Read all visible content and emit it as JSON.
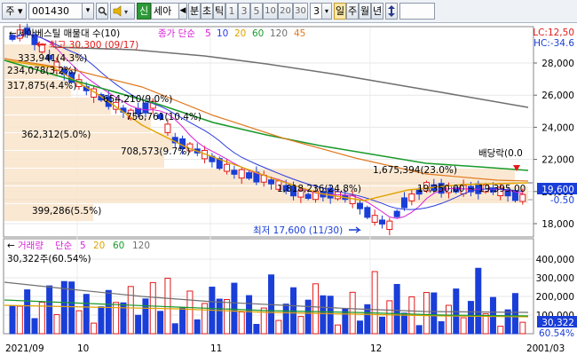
{
  "toolbar": {
    "market": "주",
    "code": "001430",
    "stock_short": "세아",
    "items": [
      "분",
      "초",
      "틱",
      "1",
      "3",
      "5",
      "10",
      "20",
      "30",
      "3",
      "일",
      "주",
      "월",
      "년"
    ],
    "interval_value": "3"
  },
  "price_legend": {
    "title": "세아베스틸 매물대 수(10)",
    "ma_label": "종가 단순",
    "ma_periods": [
      "5",
      "10",
      "20",
      "60",
      "120",
      "45"
    ],
    "colors": [
      "#d81fd8",
      "#2a3ae0",
      "#e0a200",
      "#1a9a2a",
      "#707070",
      "#e07a20"
    ]
  },
  "volume_legend": {
    "title": "거래량",
    "ma_label": "단순",
    "ma_periods": [
      "5",
      "20",
      "60",
      "120"
    ],
    "colors": [
      "#d81fd8",
      "#e0a200",
      "#1a9a2a",
      "#707070"
    ],
    "current": "30,322주(60.54%)"
  },
  "price_axis": {
    "ticks": [
      "28,000",
      "26,000",
      "24,000",
      "22,000",
      "20,000",
      "18,000"
    ],
    "lc": "LC:12,50",
    "hc": "HC:-34.6",
    "current_price": "19,600",
    "current_change": "-0.50"
  },
  "volume_axis": {
    "ticks": [
      "400,000",
      "300,000",
      "200,000",
      "100,000"
    ],
    "current_volume": "30,322",
    "current_percent": "60.54%"
  },
  "x_axis": {
    "labels": [
      "2021/09",
      "10",
      "11",
      "12",
      "20",
      "01/03"
    ]
  },
  "annotations": {
    "high": "최고 30,300 (09/17)",
    "low": "최저 17,600 (11/30)",
    "ex_dividend": "배당락(0.0",
    "profile_label_1": "1,675,394(23.0%)",
    "profile_label_2": "1,818,236(24.8%)",
    "range_label": "19,350.00 ~ 19,395.00",
    "bar_labels": [
      "333,941(4.3%)",
      "234,078(3.2%)",
      "317,875(4.4%)",
      "362,312(5.0%)",
      "654,210(9.0%)",
      "756,761(10.4%)",
      "708,573(9.7%)",
      "399,286(5.5%)"
    ]
  }
}
